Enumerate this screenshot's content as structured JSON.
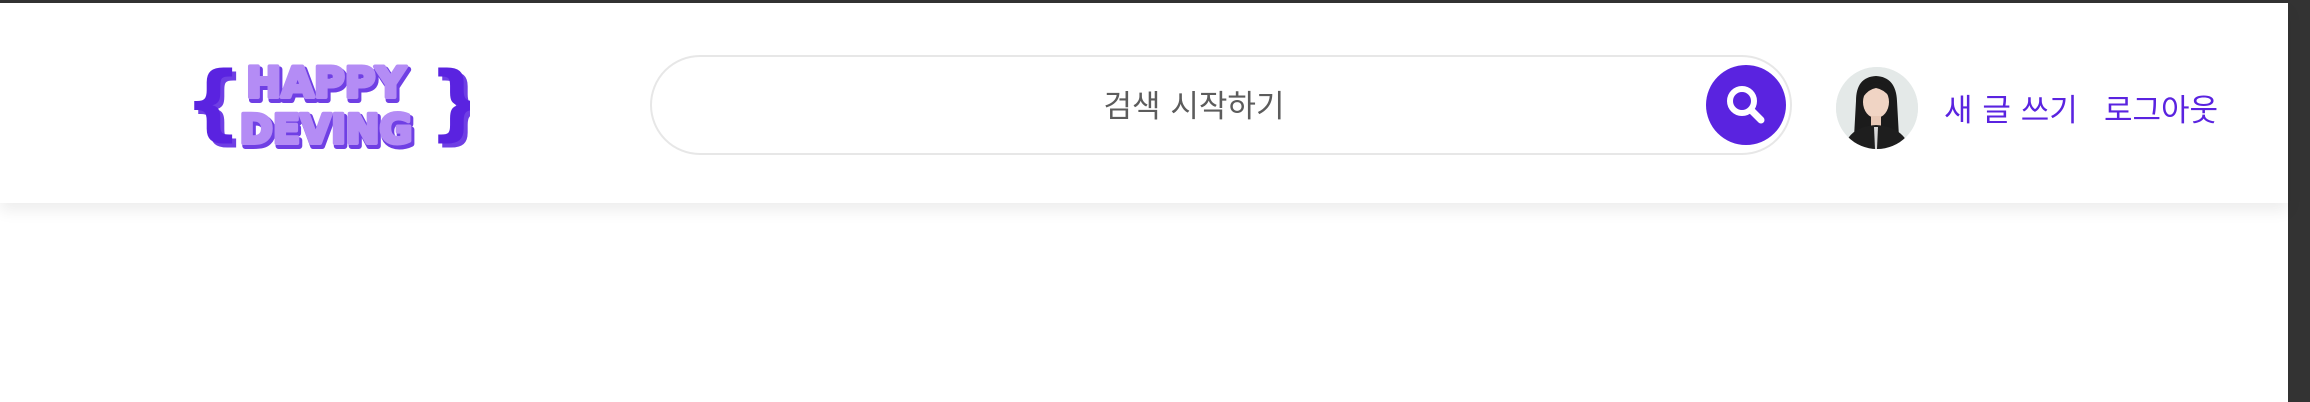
{
  "header": {
    "logo": {
      "text_line1": "HAPPY",
      "text_line2": "DEVING",
      "brace_left": "{",
      "brace_right": "}"
    },
    "search": {
      "placeholder": "검색 시작하기",
      "button_icon": "search-icon"
    },
    "user": {
      "avatar_icon": "user-avatar"
    },
    "nav": {
      "write_label": "새 글 쓰기",
      "logout_label": "로그아웃"
    }
  },
  "colors": {
    "accent": "#5a23e0",
    "logo_fill": "#b48cf5",
    "logo_shadow": "#6f3fe4",
    "frame": "#333333"
  }
}
